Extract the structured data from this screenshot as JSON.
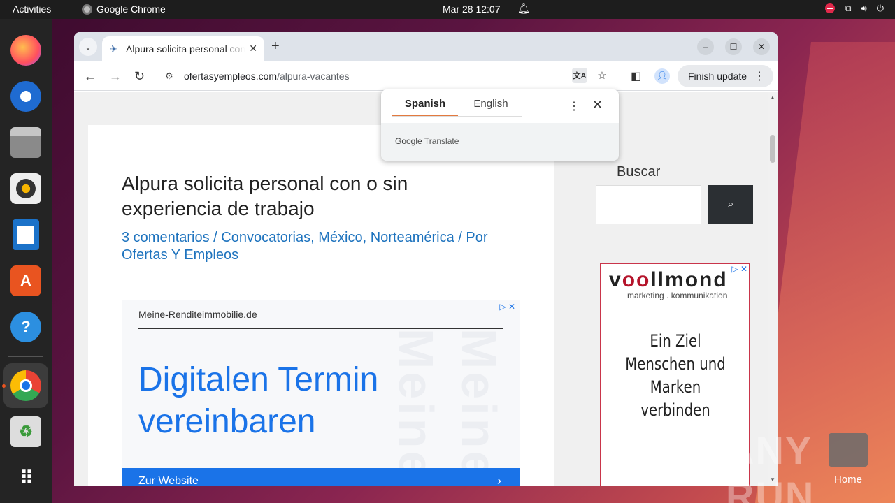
{
  "topbar": {
    "activities": "Activities",
    "app_name": "Google Chrome",
    "clock": "Mar 28  12:07"
  },
  "dock": {
    "items": [
      "firefox-icon",
      "thunderbird-icon",
      "files-icon",
      "rhythmbox-icon",
      "writer-icon",
      "app-center-icon",
      "help-icon",
      "chrome-icon",
      "trash-icon",
      "show-apps-icon"
    ],
    "help_glyph": "?"
  },
  "browser": {
    "tab_title": "Alpura solicita personal con o sin experiencia de trabajo",
    "url_domain": "ofertasyempleos.com",
    "url_path": "/alpura-vacantes",
    "finish_update": "Finish update"
  },
  "translate": {
    "source_lang": "Spanish",
    "target_lang": "English",
    "brand": "Google",
    "service": "Translate"
  },
  "article": {
    "title": "Alpura solicita personal con o sin experiencia de trabajo",
    "meta": "3 comentarios / Convocatorias, México, Norteamérica / Por Ofertas Y Empleos"
  },
  "ad1": {
    "domain": "Meine-Renditeimmobilie.de",
    "headline": "Digitalen Termin vereinbaren",
    "watermark": "Meine-",
    "cta": "Zur Website"
  },
  "sidebar": {
    "search_title": "Buscar"
  },
  "ad2": {
    "brand_v": "v",
    "brand_oo": "oo",
    "brand_rest": "llmond",
    "tagline": "marketing . kommunikation",
    "message": "Ein Ziel Menschen und Marken verbinden"
  },
  "desktop": {
    "home_label": "Home",
    "watermark": "ANY RUN"
  },
  "colors": {
    "accent_link": "#1e73be",
    "ad_blue": "#1a73e8",
    "translate_underline": "#e37a3f",
    "dock_active_dot": "#e95420"
  }
}
